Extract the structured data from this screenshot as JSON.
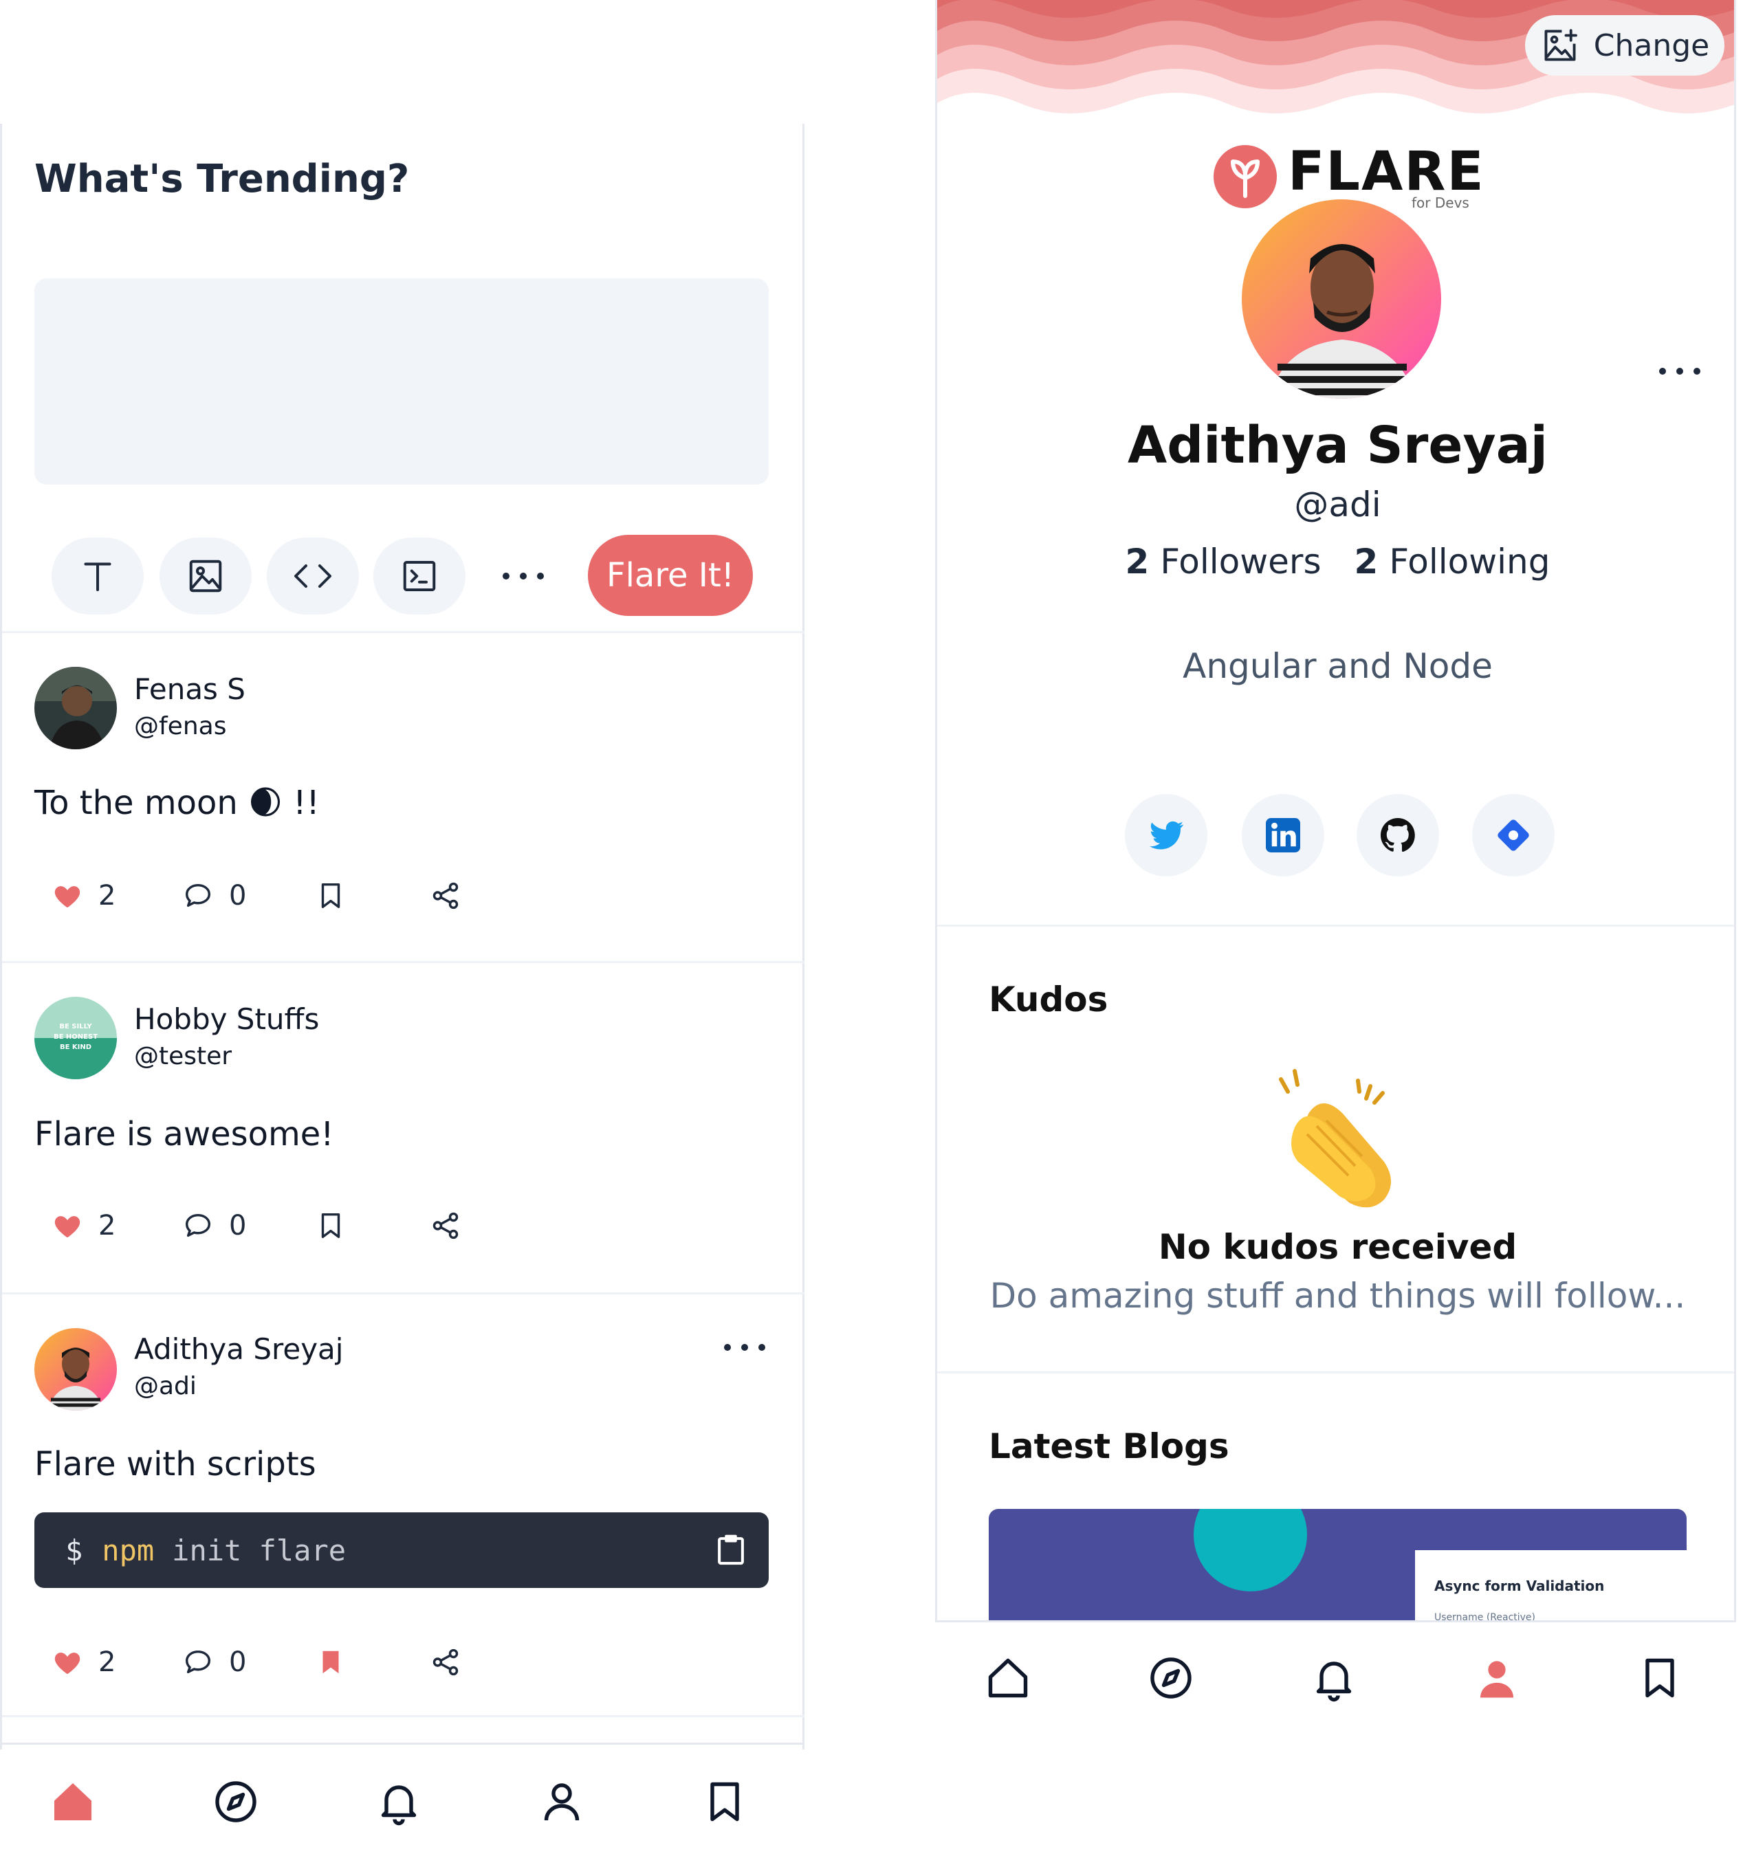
{
  "feed": {
    "title": "What's Trending?",
    "compose": {
      "tools": [
        "text-icon",
        "image-icon",
        "code-icon",
        "terminal-icon",
        "more-icon"
      ],
      "submit_label": "Flare It!"
    },
    "posts": [
      {
        "name": "Fenas S",
        "handle": "@fenas",
        "text": "To the moon 🌒 !!",
        "likes": "2",
        "comments": "0",
        "bookmarked": false
      },
      {
        "name": "Hobby Stuffs",
        "handle": "@tester",
        "text": "Flare is awesome!",
        "likes": "2",
        "comments": "0",
        "bookmarked": false,
        "avatar_lines": [
          "BE SILLY",
          "BE HONEST",
          "BE KIND"
        ]
      },
      {
        "name": "Adithya Sreyaj",
        "handle": "@adi",
        "text": "Flare with scripts",
        "likes": "2",
        "comments": "0",
        "bookmarked": true,
        "code": {
          "prompt": "$",
          "command": "npm",
          "args": "init flare"
        }
      }
    ],
    "nav": [
      "home-icon",
      "explore-icon",
      "notifications-icon",
      "profile-icon",
      "bookmarks-icon"
    ],
    "nav_active": "home-icon"
  },
  "profile": {
    "change_label": "Change",
    "logo": {
      "text": "FLARE",
      "sub": "for Devs"
    },
    "name": "Adithya Sreyaj",
    "handle": "@adi",
    "followers_count": "2",
    "followers_label": "Followers",
    "following_count": "2",
    "following_label": "Following",
    "bio": "Angular and Node",
    "social": [
      "twitter-icon",
      "linkedin-icon",
      "github-icon",
      "devto-icon"
    ],
    "kudos": {
      "title": "Kudos",
      "empty_title": "No kudos received",
      "empty_sub": "Do amazing stuff and things will follow..."
    },
    "blogs": {
      "title": "Latest Blogs",
      "card_title": "Async form Validation",
      "card_sub": "Username (Reactive)"
    },
    "nav": [
      "home-icon",
      "explore-icon",
      "notifications-icon",
      "profile-icon",
      "bookmarks-icon"
    ],
    "nav_active": "profile-icon"
  },
  "colors": {
    "accent": "#e86a6a",
    "dark": "#1e293b",
    "muted": "#64748b",
    "surface": "#f1f4f8",
    "code_bg": "#2a2f3e"
  }
}
